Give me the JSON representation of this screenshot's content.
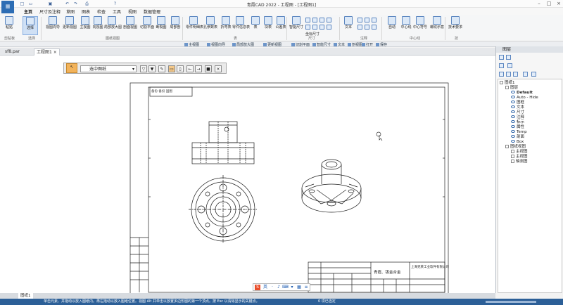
{
  "title": "青霞CAD 2022 - 工程图 - [工程图1]",
  "menus": [
    "主页",
    "尺寸及注释",
    "草图",
    "图表",
    "检查",
    "工具",
    "视图",
    "数据管理"
  ],
  "ribbon": {
    "buttons": [
      "粘贴",
      "选择",
      "视图向导",
      "更新视图",
      "主视图",
      "向视图",
      "局部放大图",
      "剖面视图",
      "切割平面",
      "断裂图",
      "局部剖",
      "零件明细表",
      "孔参数表",
      "折弯表",
      "零件信息表",
      "表",
      "块表",
      "公差表",
      "智能尺寸",
      "文本",
      "自动",
      "中心线",
      "中心符号",
      "螺纹示意",
      "技术要求"
    ],
    "groups": [
      "剪贴板",
      "选择",
      "图纸视图",
      "尺寸",
      "注释",
      "表",
      "中心线",
      "技"
    ],
    "extra_label": "坐标尺寸"
  },
  "subbar": [
    "主视图",
    "视图向导",
    "局部放大图",
    "更新视图",
    "切割平面",
    "智能尺寸",
    "文本",
    "剖视图",
    "打开",
    "保存"
  ],
  "doctabs": [
    "sf8.par",
    "工程图1"
  ],
  "floating_toolbar": {
    "select_value": "选中图纸"
  },
  "panel": {
    "header": "图层",
    "tree_root": "图纸1",
    "layers": [
      "图层",
      "Default",
      "Auto - Hide",
      "图框",
      "文本",
      "尺寸",
      "注释",
      "标示",
      "属性",
      "Temp",
      "剖面",
      "Box"
    ],
    "views_root": "图纸视图",
    "views": [
      "主视图",
      "主视图",
      "轴测图"
    ]
  },
  "drawing": {
    "title_block_company": "上海克莱工业软件有限公司",
    "title_block_part": "青霞、钣金合金",
    "header_stamp": "备份 备份 国图"
  },
  "sheettabs": [
    "图纸1"
  ],
  "status": {
    "message": "单击元素、并拖动以放入图纸内。再左拖动以放入图纸位置。视图 Alt 并单击以放置多边形图的第一个顶点。按 Esc 以清除显示的关键点。",
    "selection": "0 项已选定"
  }
}
